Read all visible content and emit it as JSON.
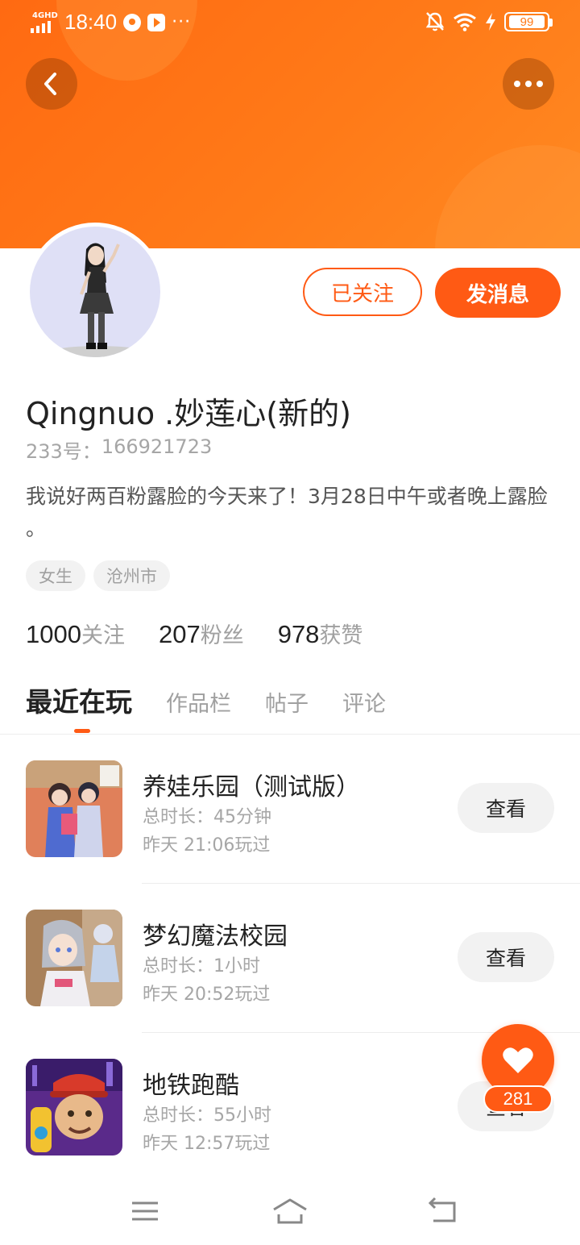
{
  "status_bar": {
    "network": "4GHD",
    "time": "18:40",
    "more": "···",
    "battery": "99",
    "icons": [
      "signal-icon",
      "meter-icon",
      "play-icon",
      "mute-bell-icon",
      "wifi-icon",
      "charging-icon",
      "battery-icon"
    ]
  },
  "header": {
    "back_icon": "chevron-left-icon",
    "more_icon": "more-dots-icon",
    "accent_color": "#ff6a12"
  },
  "profile": {
    "avatar": "avatar",
    "followed_label": "已关注",
    "message_label": "发消息",
    "name": "Qingnuo .妙莲心(新的)",
    "id_label": "233号：",
    "id_value": "166921723",
    "bio": "我说好两百粉露脸的今天来了！3月28日中午或者晚上露脸 。",
    "tags": [
      "女生",
      "沧州市"
    ],
    "stats": [
      {
        "value": "1000",
        "label": "关注"
      },
      {
        "value": "207",
        "label": "粉丝"
      },
      {
        "value": "978",
        "label": "获赞"
      }
    ]
  },
  "tabs": [
    {
      "label": "最近在玩",
      "active": true
    },
    {
      "label": "作品栏",
      "active": false
    },
    {
      "label": "帖子",
      "active": false
    },
    {
      "label": "评论",
      "active": false
    }
  ],
  "games": [
    {
      "title": "养娃乐园（测试版）",
      "duration_label": "总时长：",
      "duration": "45分钟",
      "last_played": "昨天 21:06玩过",
      "button": "查看"
    },
    {
      "title": "梦幻魔法校园",
      "duration_label": "总时长：",
      "duration": "1小时",
      "last_played": "昨天 20:52玩过",
      "button": "查看"
    },
    {
      "title": "地铁跑酷",
      "duration_label": "总时长：",
      "duration": "55小时",
      "last_played": "昨天 12:57玩过",
      "button": "查看"
    }
  ],
  "fab": {
    "icon": "heart-icon",
    "count": "281"
  },
  "system_nav": [
    "menu-icon",
    "home-icon",
    "back-icon"
  ]
}
